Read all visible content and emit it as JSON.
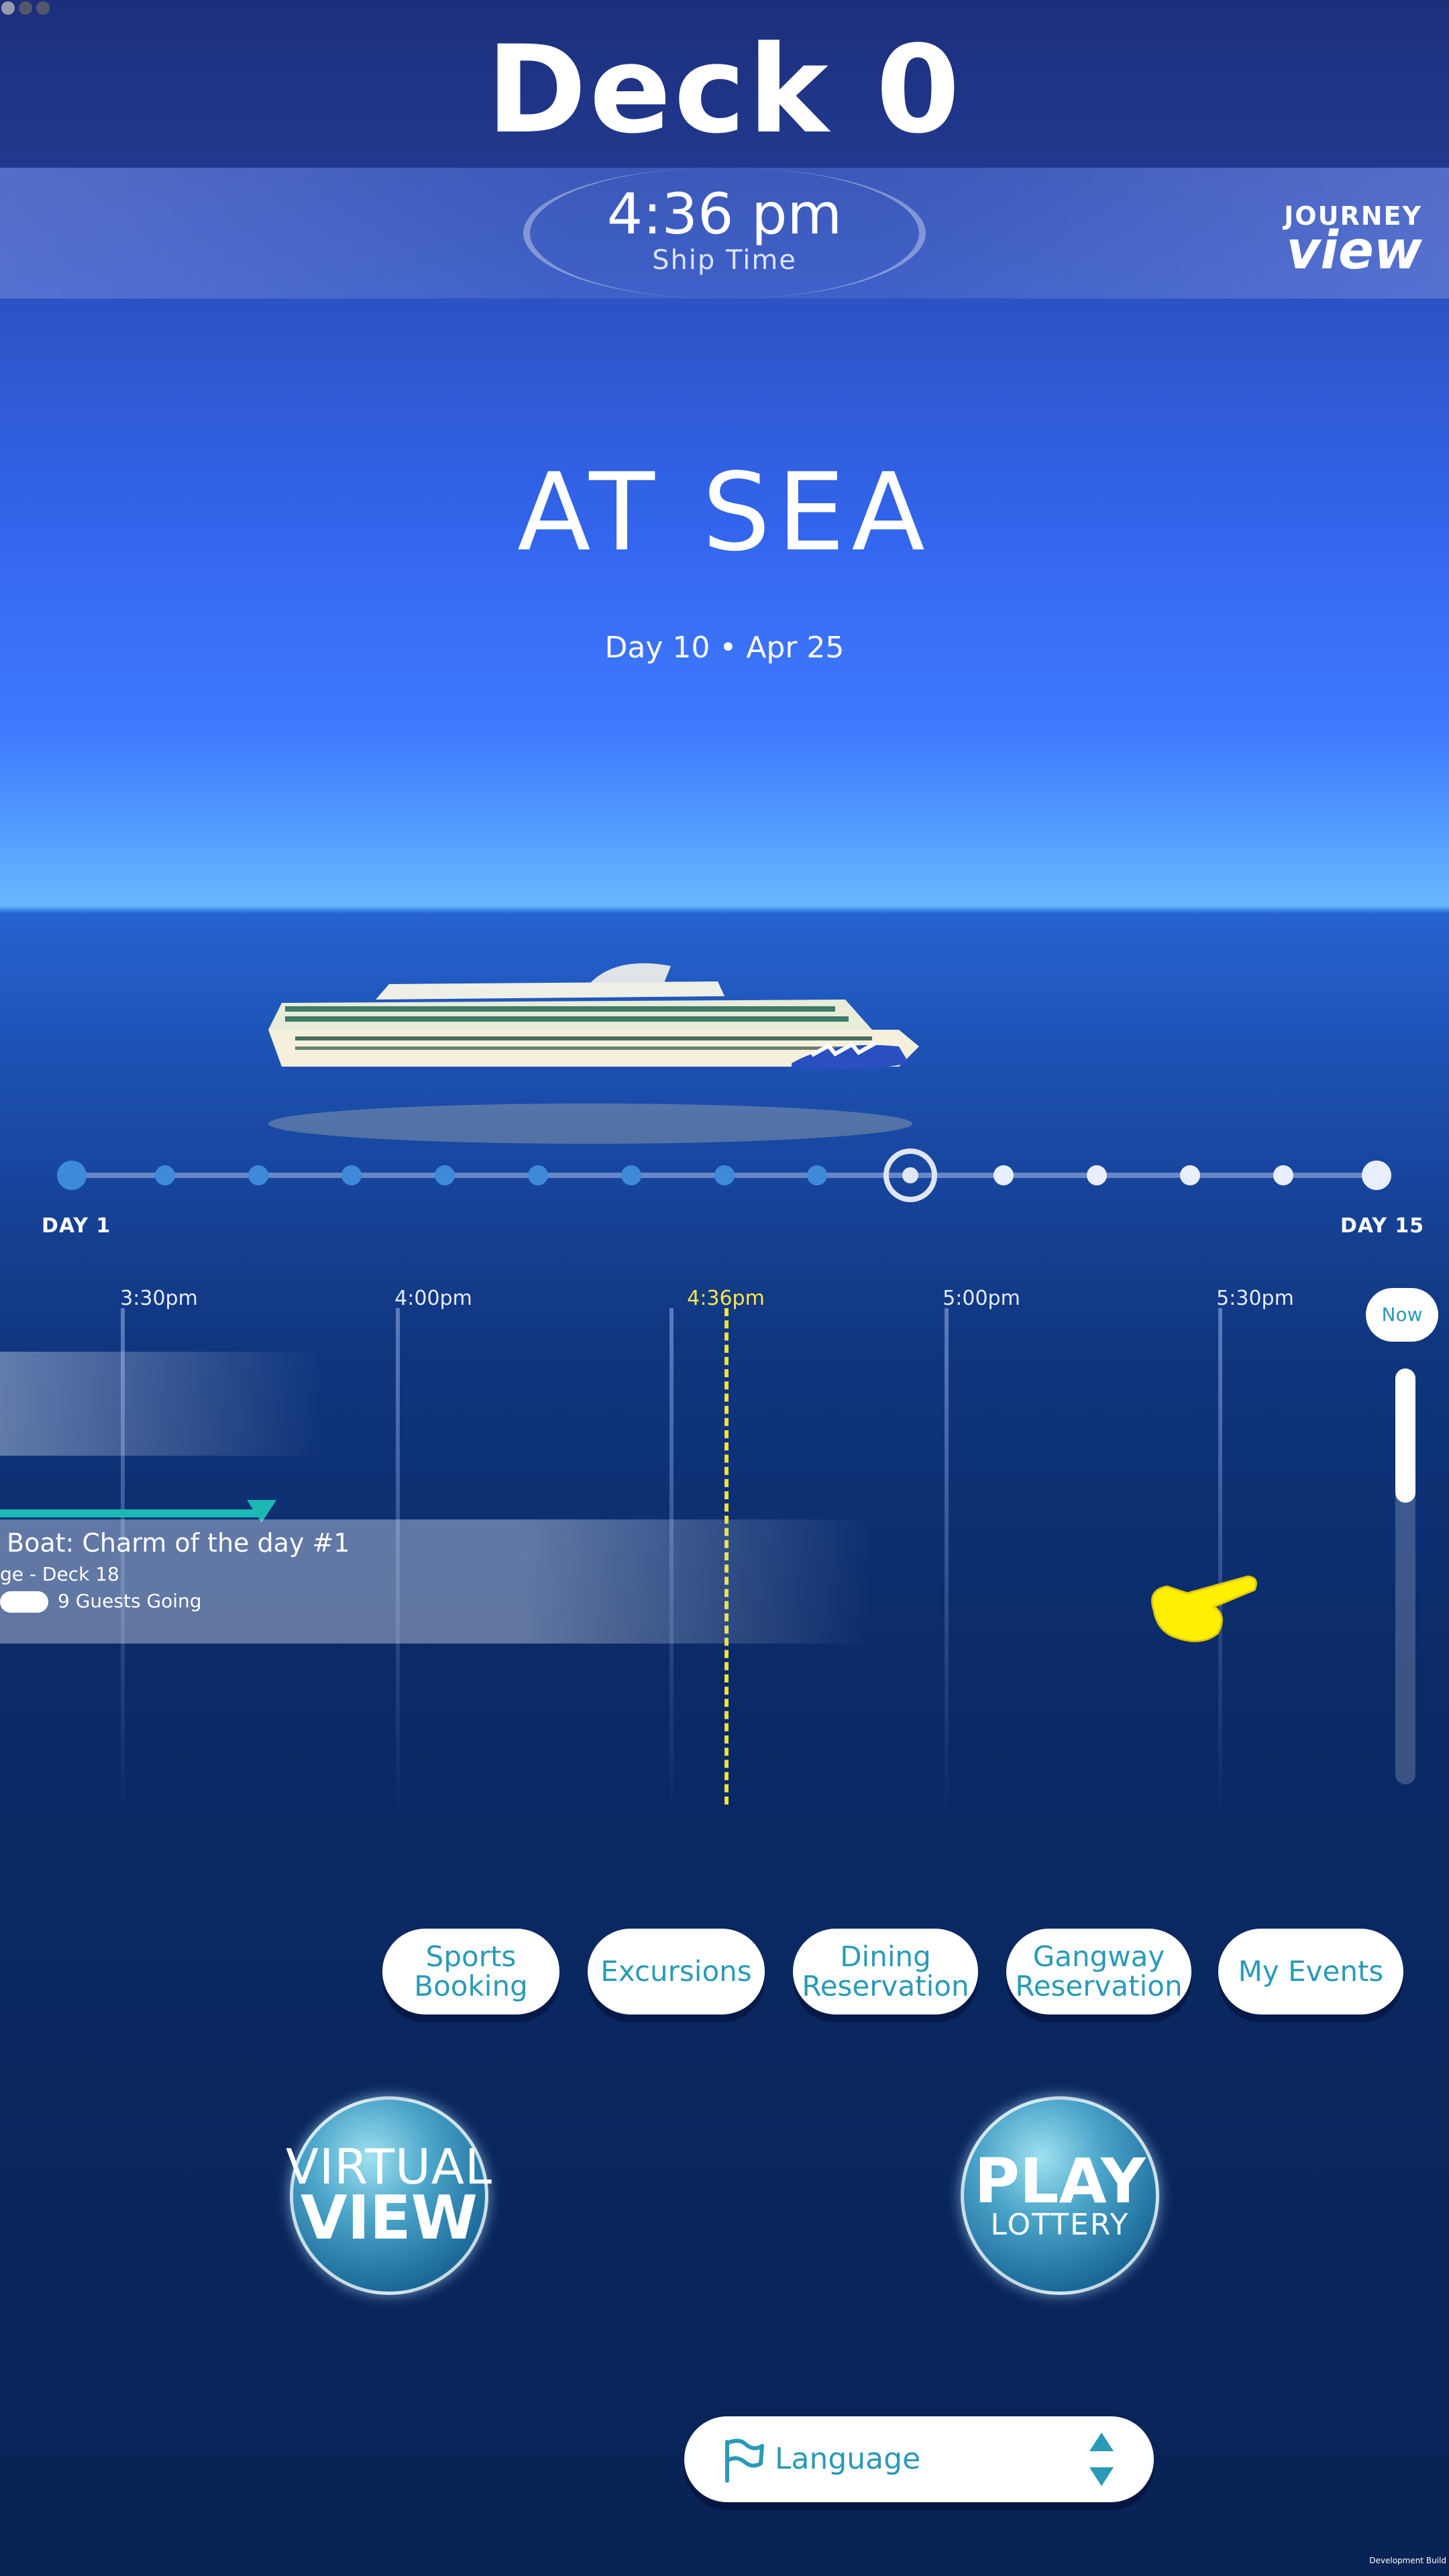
{
  "header": {
    "deck_title": "Deck 0",
    "ship_time": "4:36 pm",
    "ship_time_label": "Ship Time",
    "brand_top": "JOURNEY",
    "brand_bottom": "view"
  },
  "status": {
    "location": "AT SEA",
    "day_date": "Day 10 • Apr 25"
  },
  "day_track": {
    "start_label": "DAY 1",
    "end_label": "DAY 15",
    "total_days": 15,
    "current_day": 10
  },
  "timeline": {
    "ticks": [
      "3:30pm",
      "4:00pm",
      "4:36pm",
      "5:00pm",
      "5:30pm"
    ],
    "now_button": "Now"
  },
  "event": {
    "title": "Boat: Charm of the day #1",
    "location": "ge  - Deck 18",
    "guests": "9 Guests Going"
  },
  "nav": {
    "sports": "Sports\nBooking",
    "excursions": "Excursions",
    "dining": "Dining\nReservation",
    "gangway": "Gangway\nReservation",
    "my_events": "My Events"
  },
  "virtual_view": {
    "line1": "VIRTUAL",
    "line2": "VIEW"
  },
  "lottery": {
    "line1": "PLAY",
    "line2": "LOTTERY"
  },
  "language": {
    "label": "Language"
  },
  "footer": {
    "build": "Development Build"
  },
  "colors": {
    "accent_teal": "#2a9ab6",
    "now_line": "#f1e13a",
    "event_bar": "#1cb8b4"
  }
}
